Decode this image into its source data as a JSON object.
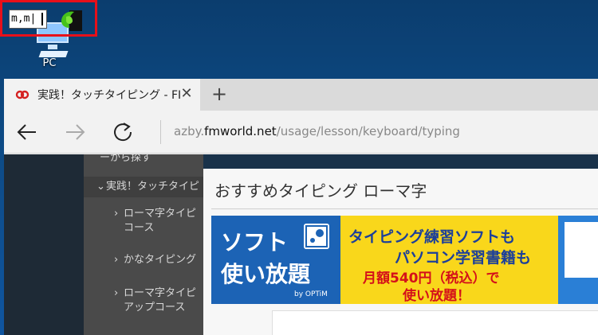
{
  "desktop": {
    "pc_label": "PC",
    "mini_input_value": "m,m|"
  },
  "browser": {
    "tab": {
      "title": "実践！タッチタイピング - FI",
      "close_glyph": "✕"
    },
    "new_tab_glyph": "+",
    "address": {
      "prefix": "azby.",
      "host": "fmworld.net",
      "path": "/usage/lesson/keyboard/typing"
    }
  },
  "page": {
    "side_menu": {
      "items": [
        {
          "label": "ーから探す"
        },
        {
          "label": "実践！タッチタイピ"
        },
        {
          "label": "ローマ字タイピ"
        },
        {
          "label": "コース"
        },
        {
          "label": "かなタイピング"
        },
        {
          "label": "ローマ字タイピ"
        },
        {
          "label": "アップコース"
        }
      ]
    },
    "modal": {
      "title": "おすすめタイピング ローマ字",
      "ad": {
        "left_line1": "ソフト",
        "left_line2": "使い放題",
        "left_by": "by OPTiM",
        "mid_line1": "タイピング練習ソフトも",
        "mid_line2": "パソコン学習書籍も",
        "mid_line3": "月額540円（税込）で",
        "mid_line4": "使い放題！"
      }
    }
  },
  "colors": {
    "highlight": "#e8101a",
    "ad_blue": "#1c63b5",
    "ad_yellow": "#f9d71b"
  }
}
